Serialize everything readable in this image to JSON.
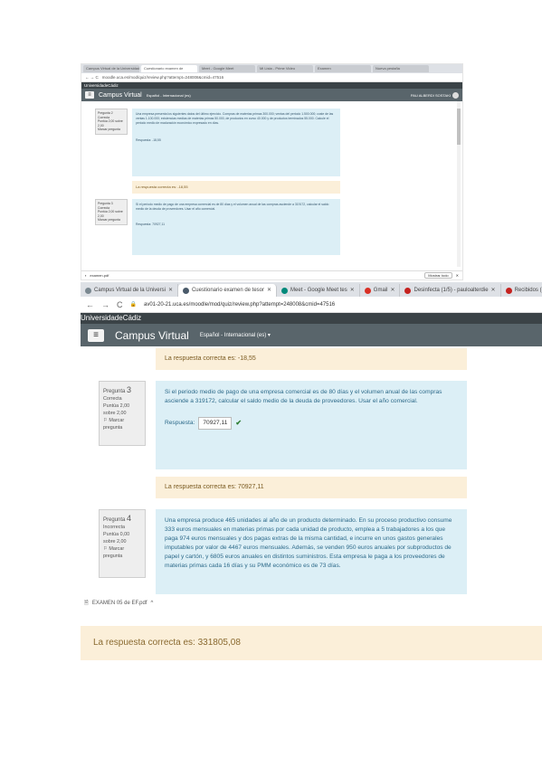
{
  "shot1": {
    "tabs": [
      "Campus Virtual de la Universidad",
      "Cuestionario examen de",
      "Meet - Google Meet",
      "Mi Lista - Prime Video",
      "Examen",
      "Nueva pestaña"
    ],
    "url": "moodle.uca.es/mod/quiz/review.php?attempt=248008&cmid=47516",
    "university": "UniversidadeCádiz",
    "campus_title": "Campus Virtual",
    "lang": "Español - Internacional (es)",
    "user": "PAU ALBERDI SOSTAKI",
    "q_side_1": [
      "Pregunta 2",
      "Correcta",
      "Puntúa 2,00 sobre 2,00",
      "Marcar pregunta"
    ],
    "q_text_1": "Una empresa presenta los siguientes datos del último ejercicio. Compras de materias primas 300.000; ventas del periodo 1.500.000; coste de las ventas 1.100.000; existencias medias de materias primas 50.000, de productos en curso 40.000 y de productos terminados 55.000. Calcule el periodo medio de maduración económico expresado en días.",
    "q_resp_1": "Respuesta: -18,55",
    "ans_1": "La respuesta correcta es: -18,55",
    "q_side_2": [
      "Pregunta 3",
      "Correcta",
      "Puntúa 2,00 sobre 2,00",
      "Marcar pregunta"
    ],
    "q_text_2": "Si el periodo medio de pago de una empresa comercial es de 80 días y el volumen anual de las compras asciende a 319172, calcular el saldo medio de la deuda de proveedores. Usar el año comercial.",
    "q_resp_2": "Respuesta: 70927,11",
    "download_name": "examen.pdf",
    "show_all": "Mostrar todo"
  },
  "shot2": {
    "tabs": [
      {
        "label": "Campus Virtual de la Universi",
        "color": "#7a8890",
        "active": false
      },
      {
        "label": "Cuestionario examen de tesor",
        "color": "#4a5a6a",
        "active": true
      },
      {
        "label": "Meet - Google Meet tes",
        "color": "#00897b",
        "active": false
      },
      {
        "label": "Gmail",
        "color": "#d93025",
        "active": false
      },
      {
        "label": "Desinfecta (1/5) - pauloalterdie",
        "color": "#c5221f",
        "active": false
      },
      {
        "label": "Recibidos (1/5) - pau",
        "color": "#c5221f",
        "active": false
      }
    ],
    "nav": [
      "←",
      "→",
      "C"
    ],
    "url": "av01-20-21.uca.es/moodle/mod/quiz/review.php?attempt=248008&cmid=47516",
    "university": "UniversidadeCádiz",
    "campus_title": "Campus Virtual",
    "lang": "Español - Internacional (es) ▾",
    "menu_icon": "≡",
    "ans_top": "La respuesta correcta es: -18,55",
    "q3": {
      "side": {
        "num_label": "Pregunta",
        "num": "3",
        "status": "Correcta",
        "score": "Puntúa 2,00 sobre 2,00",
        "flag": "Marcar pregunta"
      },
      "text": "Si el periodo medio de pago de una empresa comercial es de 80 días y el volumen anual de las compras asciende a 319172, calcular el saldo medio de la deuda de proveedores. Usar el año comercial.",
      "resp_label": "Respuesta:",
      "resp_value": "70927,11",
      "check": "✔"
    },
    "ans_q3": "La respuesta correcta es: 70927,11",
    "q4": {
      "side": {
        "num_label": "Pregunta",
        "num": "4",
        "status": "Incorrecta",
        "score": "Puntúa 0,00 sobre 2,00",
        "flag": "Marcar pregunta"
      },
      "text": "Una empresa produce 465 unidades al año de un producto determinado. En su proceso productivo consume 333 euros mensuales en materias primas por cada unidad de producto, emplea a 5 trabajadores a los que paga 974 euros mensuales y dos pagas extras de la misma cantidad, e incurre en unos gastos generales imputables por valor de 4467 euros mensuales. Además, se venden 950 euros anuales por subproductos de papel y cartón, y 6805 euros anuales en distintos suministros. Esta empresa le paga a los proveedores de materias primas cada 16 días y su PMM económico es de 73 días."
    }
  },
  "download": {
    "file": "EXAMEN 05 de EF.pdf",
    "chevron": "^"
  },
  "bottom_answer": "La respuesta correcta es: 331805,08"
}
